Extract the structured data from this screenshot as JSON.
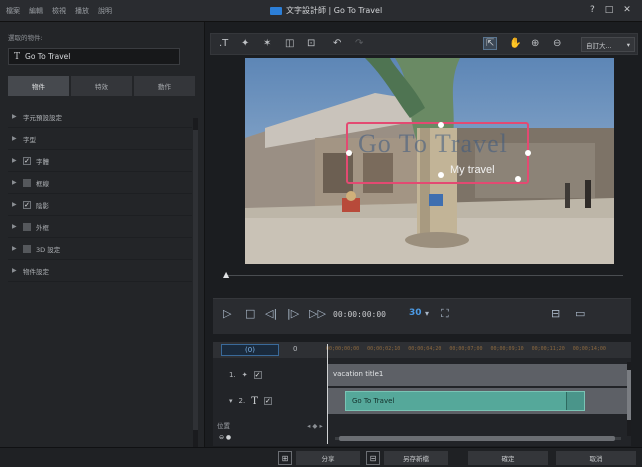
{
  "titlebar": {
    "menu": [
      "檔案",
      "編輯",
      "檢視",
      "播放",
      "說明"
    ],
    "app_title": "文字設計師 | Go To Travel",
    "buttons": [
      "?",
      "□",
      "✕"
    ]
  },
  "left_panel": {
    "object_label": "選取的物件:",
    "object_name": "Go To Travel",
    "tabs": [
      "物件",
      "特效",
      "動作"
    ],
    "active_tab": 0,
    "properties": [
      {
        "label": "字元預設設定",
        "checkbox": null
      },
      {
        "label": "字型",
        "checkbox": null
      },
      {
        "label": "字體",
        "checkbox": "checked"
      },
      {
        "label": "框線",
        "checkbox": "unchecked"
      },
      {
        "label": "陰影",
        "checkbox": "checked"
      },
      {
        "label": "外框",
        "checkbox": "unchecked"
      },
      {
        "label": "3D 設定",
        "checkbox": "unchecked"
      },
      {
        "label": "物件設定",
        "checkbox": null
      }
    ]
  },
  "toolbar": {
    "zoom_value": "自訂大..."
  },
  "preview": {
    "overlay_title": "Go To Travel",
    "overlay_subtitle": "My travel"
  },
  "playback": {
    "timecode": "00:00:00:00",
    "fps": "30"
  },
  "timeline": {
    "tab_label": "(0)",
    "tab2_label": "0",
    "ruler": [
      "00;00;00;00",
      "00;00;02;10",
      "00;00;04;20",
      "00;00;07;00",
      "00;00;09;10",
      "00;00;11;20",
      "00;00;14;00"
    ],
    "tracks": [
      {
        "num": "1.",
        "label": "vacation title1"
      },
      {
        "num": "2.",
        "clip": "Go To Travel"
      }
    ],
    "position_label": "位置"
  },
  "bottom_bar": {
    "share_label": "分享",
    "save_template_label": "另存新檔",
    "ok_label": "確定",
    "cancel_label": "取消"
  }
}
